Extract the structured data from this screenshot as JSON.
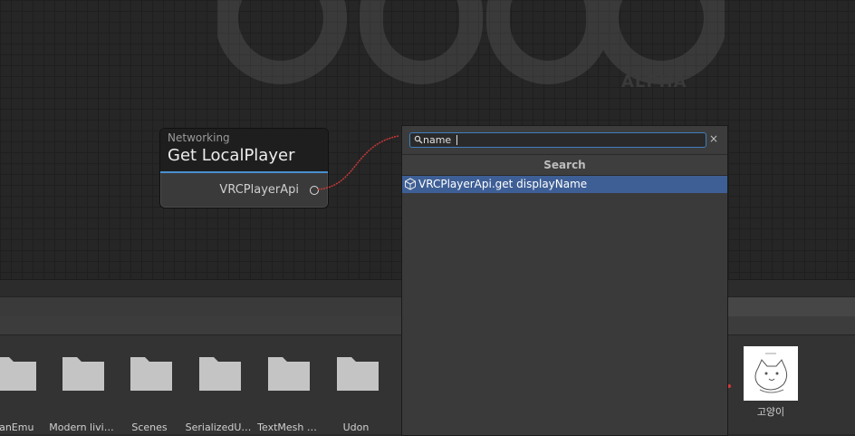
{
  "graph": {
    "watermark_sub": "ALPHA"
  },
  "node": {
    "category": "Networking",
    "title": "Get LocalPlayer",
    "output_label": "VRCPlayerApi"
  },
  "search": {
    "query": "name",
    "heading": "Search",
    "clear_glyph": "×",
    "results": [
      {
        "label": "VRCPlayerApi.get displayName",
        "icon": "cube-icon"
      }
    ]
  },
  "project": {
    "folders": [
      {
        "label": "yanEmu"
      },
      {
        "label": "Modern livi…"
      },
      {
        "label": "Scenes"
      },
      {
        "label": "SerializedU…"
      },
      {
        "label": "TextMesh …"
      },
      {
        "label": "Udon"
      }
    ],
    "asset_label": "고양이"
  },
  "colors": {
    "accent": "#4a8fd0",
    "selection": "#3e5f96",
    "wire": "#c83838"
  }
}
